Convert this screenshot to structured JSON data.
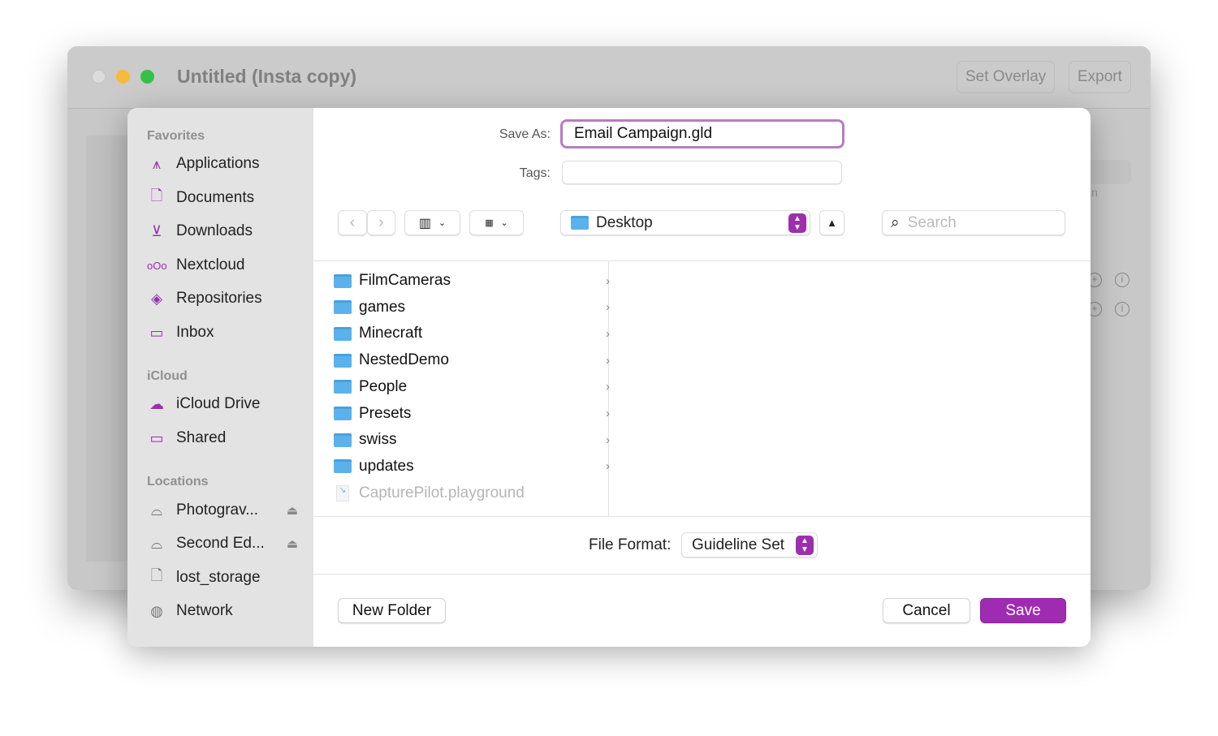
{
  "window": {
    "title": "Untitled (Insta copy)",
    "buttons": [
      "Set Overlay",
      "Export"
    ],
    "bg_text": "in"
  },
  "sidebar": {
    "sections": [
      {
        "title": "Favorites",
        "items": [
          {
            "label": "Applications",
            "icon": "app-store-icon"
          },
          {
            "label": "Documents",
            "icon": "document-icon"
          },
          {
            "label": "Downloads",
            "icon": "download-icon"
          },
          {
            "label": "Nextcloud",
            "icon": "nextcloud-icon"
          },
          {
            "label": "Repositories",
            "icon": "git-icon"
          },
          {
            "label": "Inbox",
            "icon": "folder-icon"
          }
        ]
      },
      {
        "title": "iCloud",
        "items": [
          {
            "label": "iCloud Drive",
            "icon": "cloud-icon"
          },
          {
            "label": "Shared",
            "icon": "shared-folder-icon"
          }
        ]
      },
      {
        "title": "Locations",
        "items": [
          {
            "label": "Photograv...",
            "icon": "drive-icon",
            "eject": true
          },
          {
            "label": "Second Ed...",
            "icon": "drive-icon",
            "eject": true
          },
          {
            "label": "lost_storage",
            "icon": "document-icon"
          },
          {
            "label": "Network",
            "icon": "globe-icon"
          }
        ]
      }
    ]
  },
  "form": {
    "save_as_label": "Save As:",
    "save_as_value": "Email Campaign.gld",
    "tags_label": "Tags:",
    "tags_value": ""
  },
  "toolbar": {
    "location": "Desktop",
    "search_placeholder": "Search"
  },
  "files": [
    {
      "name": "FilmCameras",
      "type": "folder"
    },
    {
      "name": "games",
      "type": "folder"
    },
    {
      "name": "Minecraft",
      "type": "folder"
    },
    {
      "name": "NestedDemo",
      "type": "folder"
    },
    {
      "name": "People",
      "type": "folder"
    },
    {
      "name": "Presets",
      "type": "folder"
    },
    {
      "name": "swiss",
      "type": "folder"
    },
    {
      "name": "updates",
      "type": "folder"
    },
    {
      "name": "CapturePilot.playground",
      "type": "file",
      "disabled": true
    }
  ],
  "format": {
    "label": "File Format:",
    "value": "Guideline Set"
  },
  "buttons": {
    "new_folder": "New Folder",
    "cancel": "Cancel",
    "save": "Save"
  },
  "colors": {
    "accent": "#9b2fae"
  }
}
